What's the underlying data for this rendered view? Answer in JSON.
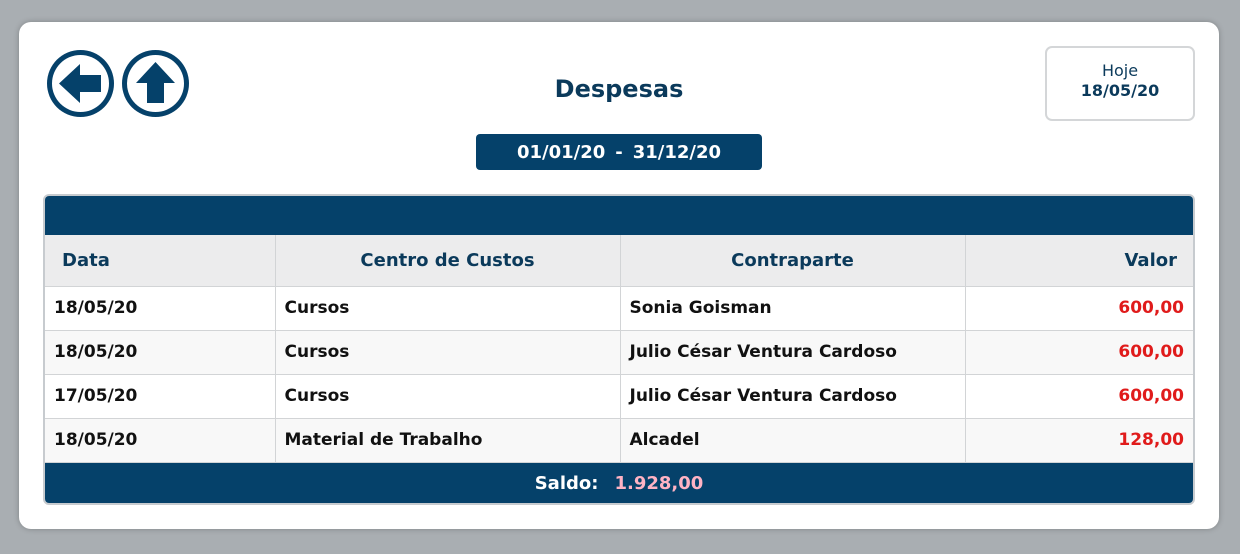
{
  "header": {
    "title": "Despesas",
    "date_from": "01/01/20",
    "date_separator": "-",
    "date_to": "31/12/20",
    "today_label": "Hoje",
    "today_date": "18/05/20"
  },
  "nav": {
    "back_icon": "arrow-left-icon",
    "up_icon": "arrow-up-icon"
  },
  "table": {
    "columns": [
      "Data",
      "Centro de Custos",
      "Contraparte",
      "Valor"
    ],
    "rows": [
      {
        "data": "18/05/20",
        "centro": "Cursos",
        "contraparte": "Sonia Goisman",
        "valor": "600,00"
      },
      {
        "data": "18/05/20",
        "centro": "Cursos",
        "contraparte": "Julio César Ventura Cardoso",
        "valor": "600,00"
      },
      {
        "data": "17/05/20",
        "centro": "Cursos",
        "contraparte": "Julio César Ventura Cardoso",
        "valor": "600,00"
      },
      {
        "data": "18/05/20",
        "centro": "Material de Trabalho",
        "contraparte": "Alcadel",
        "valor": "128,00"
      }
    ]
  },
  "footer": {
    "saldo_label": "Saldo:",
    "saldo_value": "1.928,00"
  },
  "colors": {
    "primary": "#05416a",
    "negative_value": "#e01b1b",
    "saldo_value": "#ffb3c4"
  }
}
